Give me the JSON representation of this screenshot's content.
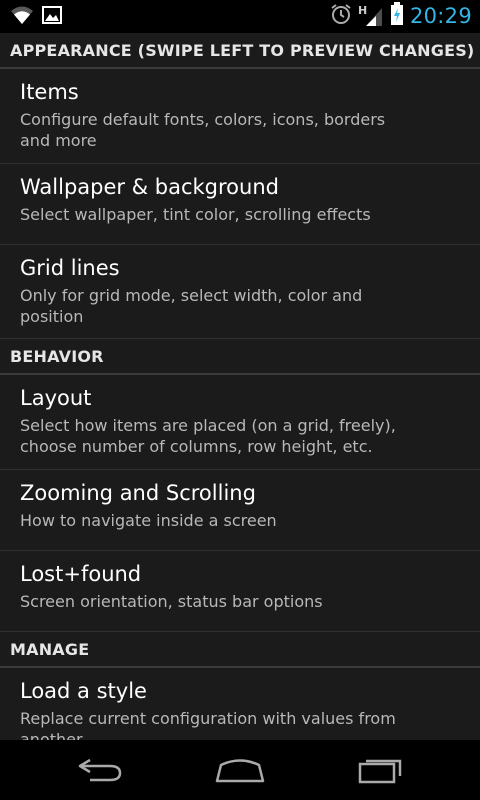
{
  "status_bar": {
    "icons_left": [
      "wifi-icon",
      "image-icon"
    ],
    "icons_right": [
      "alarm-icon",
      "signal-icon",
      "battery-icon"
    ],
    "network_letter": "H",
    "time": "20:29",
    "time_color": "#33b5e5"
  },
  "sections": [
    {
      "header": "APPEARANCE (SWIPE LEFT TO PREVIEW CHANGES)",
      "items": [
        {
          "title": "Items",
          "subtitle": "Configure default fonts, colors, icons, borders and more"
        },
        {
          "title": "Wallpaper & background",
          "subtitle": "Select wallpaper, tint color, scrolling effects"
        },
        {
          "title": "Grid lines",
          "subtitle": "Only for grid mode, select width, color and position"
        }
      ]
    },
    {
      "header": "BEHAVIOR",
      "items": [
        {
          "title": "Layout",
          "subtitle": "Select how items are placed (on a grid, freely), choose number of columns, row height, etc."
        },
        {
          "title": "Zooming and Scrolling",
          "subtitle": "How to navigate inside a screen"
        },
        {
          "title": "Lost+found",
          "subtitle": "Screen orientation, status bar options"
        }
      ]
    },
    {
      "header": "MANAGE",
      "items": [
        {
          "title": "Load a style",
          "subtitle": "Replace current configuration with values from another"
        }
      ]
    }
  ],
  "nav_bar": {
    "buttons": [
      "back-icon",
      "home-icon",
      "recent-apps-icon"
    ]
  }
}
